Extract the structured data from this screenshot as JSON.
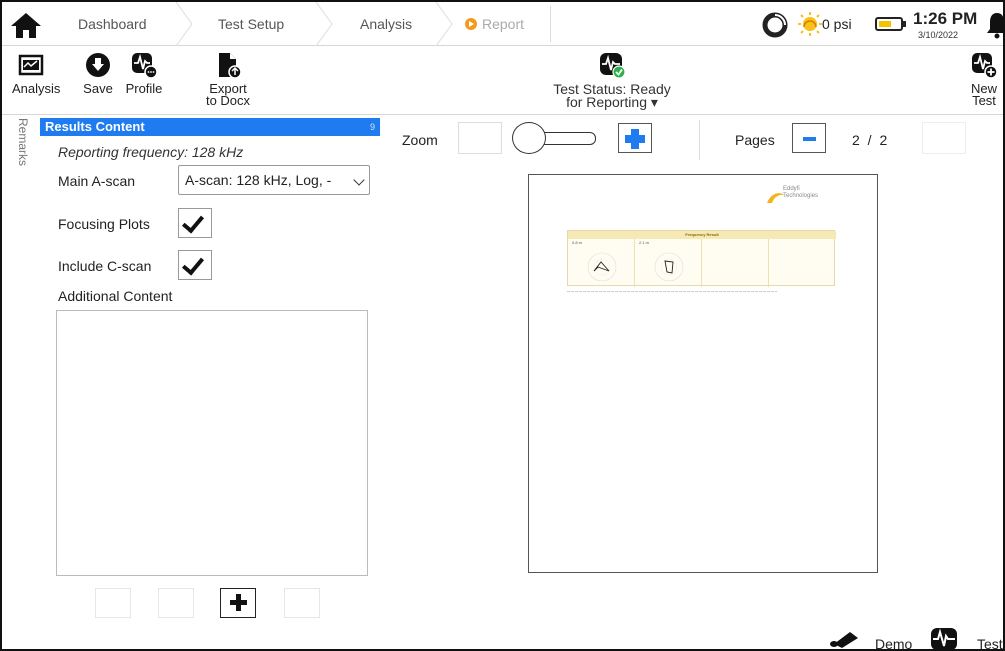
{
  "nav": {
    "crumbs": [
      {
        "label": "Dashboard"
      },
      {
        "label": "Test Setup"
      },
      {
        "label": "Analysis"
      },
      {
        "label": "Report"
      }
    ]
  },
  "status": {
    "pressure": "0 psi",
    "time": "1:26 PM",
    "date": "3/10/2022"
  },
  "toolbar": {
    "analysis": "Analysis",
    "save": "Save",
    "profile": "Profile",
    "export_line1": "Export",
    "export_line2": "to Docx",
    "test_status_line1": "Test Status: Ready",
    "test_status_line2": "for Reporting",
    "new_line1": "New",
    "new_line2": "Test"
  },
  "sidebar_tab": "Remarks",
  "results": {
    "title": "Results Content",
    "badge": "9",
    "reporting_frequency": "Reporting frequency: 128 kHz",
    "main_ascan_label": "Main A-scan",
    "main_ascan_value": "A-scan: 128 kHz, Log, -",
    "focusing_plots_label": "Focusing Plots",
    "focusing_plots_checked": true,
    "include_cscan_label": "Include C-scan",
    "include_cscan_checked": true,
    "additional_content_label": "Additional Content"
  },
  "viewer": {
    "zoom_label": "Zoom",
    "pages_label": "Pages",
    "page_current": "2",
    "page_total": "2",
    "page_display": "2 / 2"
  },
  "document": {
    "logo_line1": "Eddyfi",
    "logo_line2": "Technologies",
    "table_title": "Frequency Result",
    "plot1_label": "0.8 m",
    "plot2_label": "2.1 m"
  },
  "bottom": {
    "demo": "Demo",
    "test": "Test"
  },
  "colors": {
    "accent": "#1e7cf0",
    "report": "#f39a1e",
    "ok_green": "#2bb34a"
  }
}
